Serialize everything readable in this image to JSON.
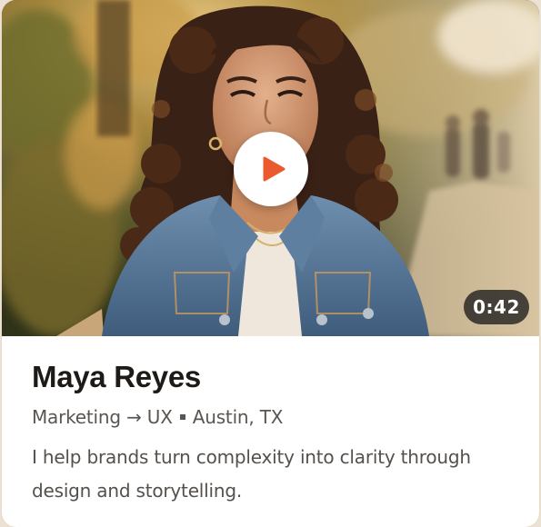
{
  "profile": {
    "name": "Maya Reyes",
    "role_from": "Marketing",
    "arrow": "→",
    "role_to": "UX",
    "location": "Austin, TX",
    "bio": "I help brands turn complexity into clarity through design and storytelling."
  },
  "video": {
    "duration": "0:42",
    "play_icon": "play-icon"
  },
  "colors": {
    "accent": "#ea5a2c",
    "badge_bg": "#1c1c1c",
    "name_text": "#1d1a17",
    "secondary_text": "#5a5550"
  }
}
